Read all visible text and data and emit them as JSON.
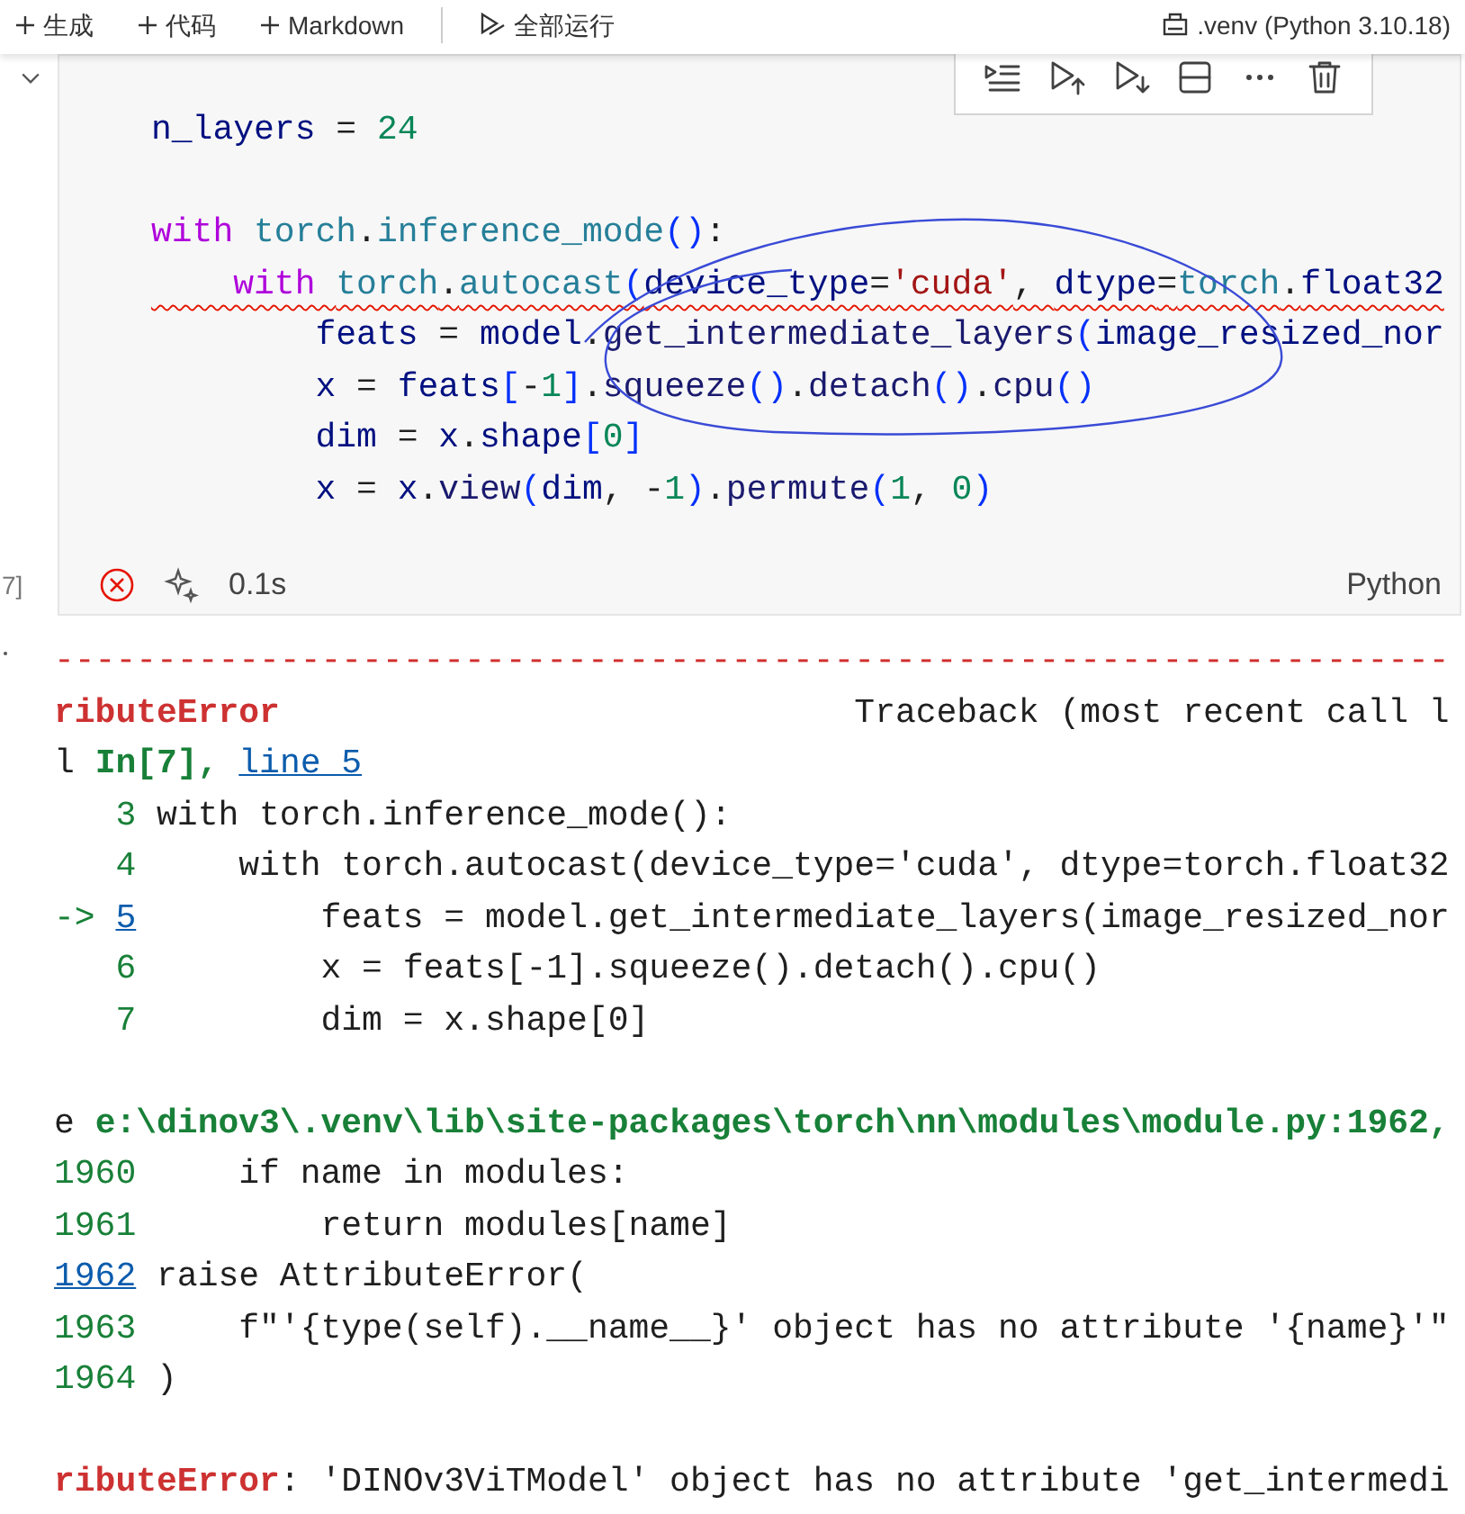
{
  "top_toolbar": {
    "items": [
      {
        "kind": "plus",
        "label": "生成"
      },
      {
        "kind": "plus",
        "label": "代码"
      },
      {
        "kind": "plus",
        "label": "Markdown"
      },
      {
        "kind": "run-all",
        "label": "全部运行"
      }
    ],
    "kernel": ".venv (Python 3.10.18)"
  },
  "cell": {
    "execution_count": "7]",
    "code_lines": [
      {
        "kind": "code",
        "squiggly": false,
        "tokens": [
          {
            "kind": "name",
            "text": "n_layers"
          },
          {
            "kind": "plain",
            "text": " = "
          },
          {
            "kind": "num",
            "text": "24"
          }
        ]
      },
      {
        "kind": "blank"
      },
      {
        "kind": "code",
        "squiggly": false,
        "tokens": [
          {
            "kind": "kw",
            "text": "with "
          },
          {
            "kind": "cls",
            "text": "torch"
          },
          {
            "kind": "plain",
            "text": "."
          },
          {
            "kind": "cls",
            "text": "inference_mode"
          },
          {
            "kind": "br",
            "text": "()"
          },
          {
            "kind": "plain",
            "text": ":"
          }
        ]
      },
      {
        "kind": "code",
        "squiggly": true,
        "tokens": [
          {
            "kind": "kw",
            "text": "    with "
          },
          {
            "kind": "cls",
            "text": "torch"
          },
          {
            "kind": "plain",
            "text": "."
          },
          {
            "kind": "cls",
            "text": "autocast"
          },
          {
            "kind": "br",
            "text": "("
          },
          {
            "kind": "name",
            "text": "device_type"
          },
          {
            "kind": "plain",
            "text": "="
          },
          {
            "kind": "str",
            "text": "'cuda'"
          },
          {
            "kind": "plain",
            "text": ", "
          },
          {
            "kind": "name",
            "text": "dtype"
          },
          {
            "kind": "plain",
            "text": "="
          },
          {
            "kind": "cls",
            "text": "torch"
          },
          {
            "kind": "plain",
            "text": "."
          },
          {
            "kind": "name",
            "text": "float32"
          }
        ]
      },
      {
        "kind": "code",
        "squiggly": false,
        "tokens": [
          {
            "kind": "name",
            "text": "        feats"
          },
          {
            "kind": "plain",
            "text": " = "
          },
          {
            "kind": "name",
            "text": "model"
          },
          {
            "kind": "plain",
            "text": "."
          },
          {
            "kind": "func",
            "text": "get_intermediate_layers"
          },
          {
            "kind": "br",
            "text": "("
          },
          {
            "kind": "name",
            "text": "image_resized_nor"
          }
        ]
      },
      {
        "kind": "code",
        "squiggly": false,
        "tokens": [
          {
            "kind": "name",
            "text": "        x"
          },
          {
            "kind": "plain",
            "text": " = "
          },
          {
            "kind": "name",
            "text": "feats"
          },
          {
            "kind": "br",
            "text": "["
          },
          {
            "kind": "plain",
            "text": "-"
          },
          {
            "kind": "num",
            "text": "1"
          },
          {
            "kind": "br",
            "text": "]"
          },
          {
            "kind": "plain",
            "text": "."
          },
          {
            "kind": "func",
            "text": "squeeze"
          },
          {
            "kind": "br",
            "text": "()"
          },
          {
            "kind": "plain",
            "text": "."
          },
          {
            "kind": "func",
            "text": "detach"
          },
          {
            "kind": "br",
            "text": "()"
          },
          {
            "kind": "plain",
            "text": "."
          },
          {
            "kind": "func",
            "text": "cpu"
          },
          {
            "kind": "br",
            "text": "()"
          }
        ]
      },
      {
        "kind": "code",
        "squiggly": false,
        "tokens": [
          {
            "kind": "name",
            "text": "        dim"
          },
          {
            "kind": "plain",
            "text": " = "
          },
          {
            "kind": "name",
            "text": "x"
          },
          {
            "kind": "plain",
            "text": "."
          },
          {
            "kind": "name",
            "text": "shape"
          },
          {
            "kind": "br",
            "text": "["
          },
          {
            "kind": "num",
            "text": "0"
          },
          {
            "kind": "br",
            "text": "]"
          }
        ]
      },
      {
        "kind": "code",
        "squiggly": false,
        "tokens": [
          {
            "kind": "name",
            "text": "        x"
          },
          {
            "kind": "plain",
            "text": " = "
          },
          {
            "kind": "name",
            "text": "x"
          },
          {
            "kind": "plain",
            "text": "."
          },
          {
            "kind": "func",
            "text": "view"
          },
          {
            "kind": "br",
            "text": "("
          },
          {
            "kind": "name",
            "text": "dim"
          },
          {
            "kind": "plain",
            "text": ", -"
          },
          {
            "kind": "num",
            "text": "1"
          },
          {
            "kind": "br",
            "text": ")"
          },
          {
            "kind": "plain",
            "text": "."
          },
          {
            "kind": "func",
            "text": "permute"
          },
          {
            "kind": "br",
            "text": "("
          },
          {
            "kind": "num",
            "text": "1"
          },
          {
            "kind": "plain",
            "text": ", "
          },
          {
            "kind": "num",
            "text": "0"
          },
          {
            "kind": "br",
            "text": ")"
          }
        ]
      }
    ],
    "duration": "0.1s",
    "language": "Python"
  },
  "output_lines": [
    {
      "kind": "text",
      "tokens": [
        {
          "kind": "dash",
          "text": "--------------------------------------------------------------------"
        }
      ]
    },
    {
      "kind": "text",
      "tokens": [
        {
          "kind": "err",
          "text": "ributeError"
        },
        {
          "kind": "plain",
          "text": "                            Traceback (most recent call l"
        }
      ]
    },
    {
      "kind": "text",
      "tokens": [
        {
          "kind": "plain",
          "text": "l "
        },
        {
          "kind": "green",
          "text": "In[7], "
        },
        {
          "kind": "link",
          "text": "line 5"
        }
      ]
    },
    {
      "kind": "text",
      "tokens": [
        {
          "kind": "lineno",
          "text": "   3"
        },
        {
          "kind": "plain",
          "text": " with torch.inference_mode():"
        }
      ]
    },
    {
      "kind": "text",
      "tokens": [
        {
          "kind": "lineno",
          "text": "   4"
        },
        {
          "kind": "plain",
          "text": "     with torch.autocast(device_type='cuda', dtype=torch.float32"
        }
      ]
    },
    {
      "kind": "text",
      "tokens": [
        {
          "kind": "lineno",
          "text": "-> "
        },
        {
          "kind": "link",
          "text": "5"
        },
        {
          "kind": "plain",
          "text": "         feats = model.get_intermediate_layers(image_resized_nor"
        }
      ]
    },
    {
      "kind": "text",
      "tokens": [
        {
          "kind": "lineno",
          "text": "   6"
        },
        {
          "kind": "plain",
          "text": "         x = feats[-1].squeeze().detach().cpu()"
        }
      ]
    },
    {
      "kind": "text",
      "tokens": [
        {
          "kind": "lineno",
          "text": "   7"
        },
        {
          "kind": "plain",
          "text": "         dim = x.shape[0]"
        }
      ]
    },
    {
      "kind": "blank"
    },
    {
      "kind": "text",
      "tokens": [
        {
          "kind": "plain",
          "text": "e "
        },
        {
          "kind": "green",
          "text": "e:\\dinov3\\.venv\\lib\\site-packages\\torch\\nn\\modules\\module.py:1962,"
        }
      ]
    },
    {
      "kind": "text",
      "tokens": [
        {
          "kind": "lineno",
          "text": "1960"
        },
        {
          "kind": "plain",
          "text": "     if name in modules:"
        }
      ]
    },
    {
      "kind": "text",
      "tokens": [
        {
          "kind": "lineno",
          "text": "1961"
        },
        {
          "kind": "plain",
          "text": "         return modules[name]"
        }
      ]
    },
    {
      "kind": "text",
      "tokens": [
        {
          "kind": "link",
          "text": "1962"
        },
        {
          "kind": "plain",
          "text": " raise AttributeError("
        }
      ]
    },
    {
      "kind": "text",
      "tokens": [
        {
          "kind": "lineno",
          "text": "1963"
        },
        {
          "kind": "plain",
          "text": "     f\"'{type(self).__name__}' object has no attribute '{name}'\""
        }
      ]
    },
    {
      "kind": "text",
      "tokens": [
        {
          "kind": "lineno",
          "text": "1964"
        },
        {
          "kind": "plain",
          "text": " )"
        }
      ]
    },
    {
      "kind": "blank"
    },
    {
      "kind": "text",
      "tokens": [
        {
          "kind": "err",
          "text": "ributeError"
        },
        {
          "kind": "plain",
          "text": ": 'DINOv3ViTModel' object has no attribute 'get_intermedi"
        }
      ]
    }
  ]
}
